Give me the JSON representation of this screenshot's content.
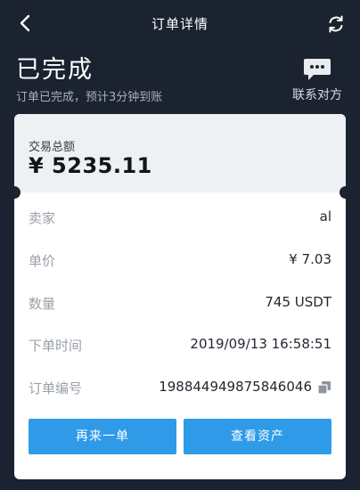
{
  "nav": {
    "title": "订单详情",
    "icons": {
      "back": "back-arrow-icon",
      "refresh": "refresh-icon"
    }
  },
  "status": {
    "title": "已完成",
    "subtitle": "订单已完成，预计3分钟到账"
  },
  "contact": {
    "label": "联系对方",
    "icon": "chat-bubble-icon"
  },
  "order": {
    "total_label": "交易总额",
    "total_value": "¥ 5235.11",
    "seller_label": "卖家",
    "seller_value": "al",
    "price_label": "单价",
    "price_value": "¥ 7.03",
    "quantity_label": "数量",
    "quantity_value": "745 USDT",
    "time_label": "下单时间",
    "time_value": "2019/09/13 16:58:51",
    "number_label": "订单编号",
    "number_value": "198844949875846046"
  },
  "actions": {
    "reorder_label": "再来一单",
    "view_assets_label": "查看资产"
  },
  "colors": {
    "background": "#1b2230",
    "button": "#2f9be8",
    "card": "#ffffff",
    "card_header": "#eef1f4"
  }
}
